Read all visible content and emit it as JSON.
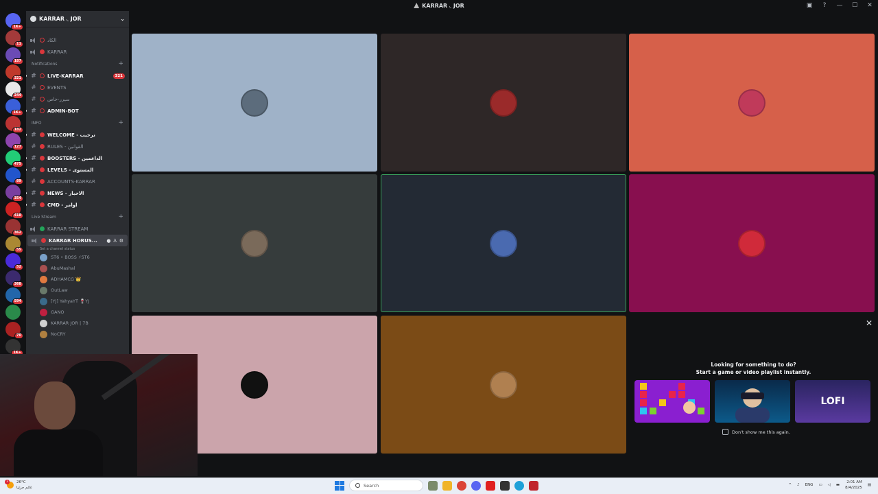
{
  "window": {
    "title": "KARRAR ◟ JOR"
  },
  "servers": [
    {
      "color": "#5865f2",
      "badge": "1K+"
    },
    {
      "color": "#a33a3a",
      "badge": "11"
    },
    {
      "color": "#6b4bb5",
      "badge": "187"
    },
    {
      "color": "#c0392b",
      "badge": "321"
    },
    {
      "color": "#e8e8e8",
      "badge": "244"
    },
    {
      "color": "#3a5fd9",
      "badge": "1K+"
    },
    {
      "color": "#b33",
      "badge": "182"
    },
    {
      "color": "#8e44ad",
      "badge": "127"
    },
    {
      "color": "#2c7",
      "badge": "475"
    },
    {
      "color": "#2255cc",
      "badge": "89"
    },
    {
      "color": "#7a3fa0",
      "badge": "354"
    },
    {
      "color": "#c22",
      "badge": "418"
    },
    {
      "color": "#933",
      "badge": "362"
    },
    {
      "color": "#a83",
      "badge": "55"
    },
    {
      "color": "#4a2bd9",
      "badge": "52"
    },
    {
      "color": "#3b2a6e",
      "badge": "368"
    },
    {
      "color": "#2266aa",
      "badge": "594"
    },
    {
      "color": "#2a8a4a",
      "badge": ""
    },
    {
      "color": "#aa2222",
      "badge": "70"
    },
    {
      "color": "#333",
      "badge": "1K+"
    }
  ],
  "guild": {
    "name": "KARRAR ◟ JOR"
  },
  "channels_top": [
    {
      "name": "الكاد",
      "bold": false
    },
    {
      "name": "KARRAR",
      "bold": false
    }
  ],
  "categories": {
    "notifications": "Notifications",
    "info": "INFO",
    "live": "Live Stream"
  },
  "notif_channels": [
    {
      "name": "LIVE-KARRAR",
      "bold": true,
      "badge": "321"
    },
    {
      "name": "EVENTS",
      "bold": false,
      "badge": ""
    },
    {
      "name": "سيرر-خاص",
      "bold": false,
      "badge": ""
    },
    {
      "name": "ADMIN-BOT",
      "bold": true,
      "badge": ""
    }
  ],
  "info_channels": [
    {
      "name": "WELCOME - ترحيب",
      "bold": true
    },
    {
      "name": "RULES - القوانين",
      "bold": false
    },
    {
      "name": "BOOSTERS - الداعمين",
      "bold": true
    },
    {
      "name": "LEVELS - المستوى",
      "bold": true
    },
    {
      "name": "ACCOUNTS-KARRAR",
      "bold": false
    },
    {
      "name": "NEWS - الاخبار",
      "bold": true
    },
    {
      "name": "CMD - اوامر",
      "bold": true
    }
  ],
  "live_channels": {
    "stream": "KARRAR STREAM",
    "selected": "KARRAR HORUS...",
    "status_hint": "Set a channel status"
  },
  "voice_users": [
    {
      "name": "ST6 • BOSS ⚡ST6",
      "color": "#7aa0c8"
    },
    {
      "name": "AbuMashal",
      "color": "#a85050"
    },
    {
      "name": "ADHAMCG 👑",
      "color": "#e07a40"
    },
    {
      "name": "OutLaw",
      "color": "#6a7a6a"
    },
    {
      "name": "[YJ] YahyaYT 🍷YJ",
      "color": "#3a6a8a"
    },
    {
      "name": "GANO",
      "color": "#c02040"
    },
    {
      "name": "KARRAR JOR | 7B",
      "color": "#d0d0d0"
    },
    {
      "name": "NoCRY",
      "color": "#b08040"
    }
  ],
  "tiles": [
    {
      "bg": "#9fb2c8",
      "avatar": "#5c6c7c",
      "speaking": false
    },
    {
      "bg": "#2e2727",
      "avatar": "#9a2a2a",
      "speaking": false
    },
    {
      "bg": "#d6604a",
      "avatar": "#c03a5a",
      "speaking": false
    },
    {
      "bg": "#363c3c",
      "avatar": "#7a6a5a",
      "speaking": false
    },
    {
      "bg": "#232a34",
      "avatar": "#4a6ab0",
      "speaking": true
    },
    {
      "bg": "#880f4f",
      "avatar": "#d02a3a",
      "speaking": false
    },
    {
      "bg": "#cba4ab",
      "avatar": "#111",
      "speaking": false
    },
    {
      "bg": "#7b4b16",
      "avatar": "#b08050",
      "speaking": false
    }
  ],
  "activity": {
    "line1": "Looking for something to do?",
    "line2": "Start a game or video playlist instantly.",
    "card3_label": "LOFI",
    "dont_show": "Don't show me this again."
  },
  "taskbar": {
    "weather_temp": "26°C",
    "weather_desc": "غائم جزئيا",
    "weather_badge": "3",
    "search_placeholder": "Search",
    "lang": "ENG",
    "time": "2:01 AM",
    "date": "8/4/2025"
  }
}
